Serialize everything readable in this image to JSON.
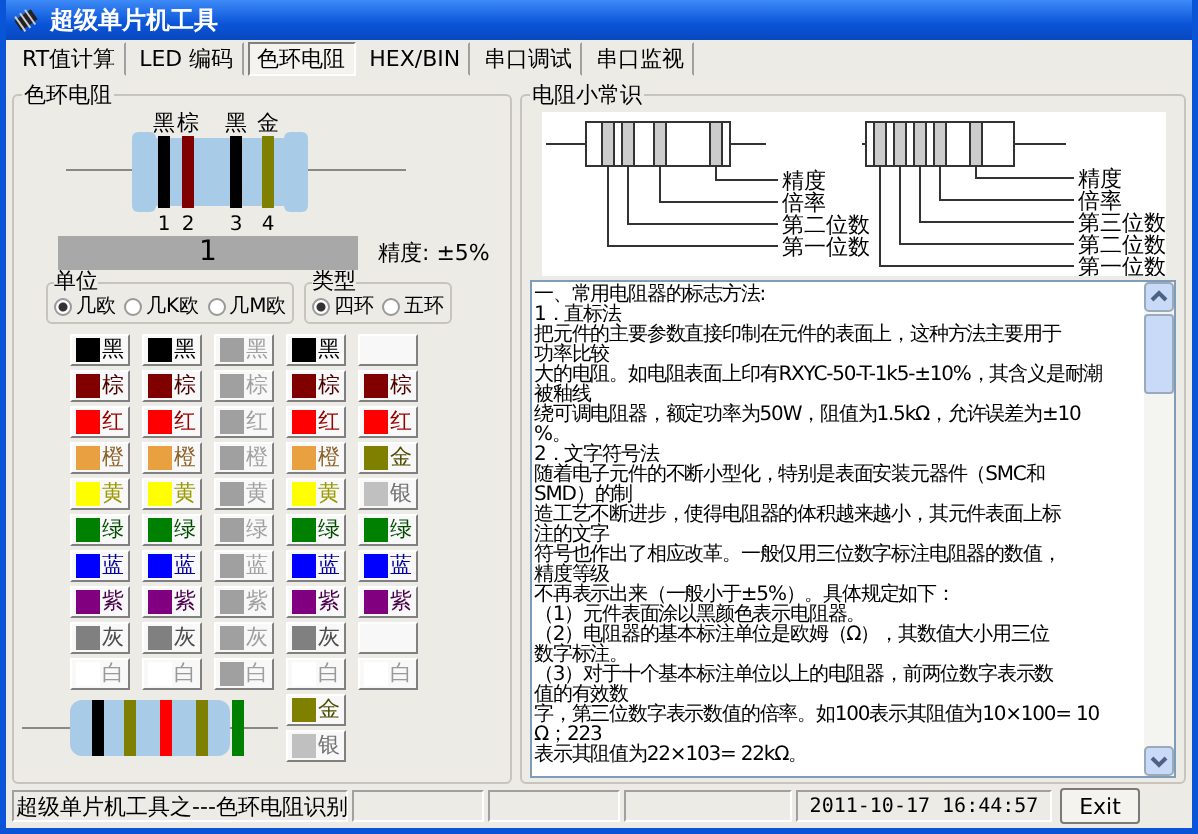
{
  "window": {
    "title": "超级单片机工具"
  },
  "tabs": [
    {
      "label": "RT值计算",
      "selected": false
    },
    {
      "label": "LED 编码",
      "selected": false
    },
    {
      "label": "色环电阻",
      "selected": true
    },
    {
      "label": "HEX/BIN",
      "selected": false
    },
    {
      "label": "串口调试",
      "selected": false
    },
    {
      "label": "串口监视",
      "selected": false
    }
  ],
  "color_ring_panel": {
    "title": "色环电阻",
    "resistor": {
      "bands": [
        {
          "name": "黑",
          "number": "1",
          "color": "#000000"
        },
        {
          "name": "棕",
          "number": "2",
          "color": "#800000"
        },
        {
          "name": "黑",
          "number": "3",
          "color": "#000000"
        },
        {
          "name": "金",
          "number": "4",
          "color": "#808000"
        }
      ]
    },
    "value": "1",
    "precision": "精度: ±5%",
    "unit_group": {
      "title": "单位",
      "options": [
        {
          "label": "几欧",
          "selected": true
        },
        {
          "label": "几K欧",
          "selected": false
        },
        {
          "label": "几M欧",
          "selected": false
        }
      ]
    },
    "type_group": {
      "title": "类型",
      "options": [
        {
          "label": "四环",
          "selected": true
        },
        {
          "label": "五环",
          "selected": false
        }
      ]
    },
    "band_columns": [
      {
        "disabled": false,
        "buttons": [
          {
            "kind": "swatch",
            "label": "黑",
            "color": "#000000"
          },
          {
            "kind": "swatch",
            "label": "棕",
            "color": "#800000"
          },
          {
            "kind": "swatch",
            "label": "红",
            "color": "#ff0000"
          },
          {
            "kind": "swatch",
            "label": "橙",
            "color": "#e8a040"
          },
          {
            "kind": "swatch",
            "label": "黄",
            "color": "#ffff00"
          },
          {
            "kind": "swatch",
            "label": "绿",
            "color": "#008000"
          },
          {
            "kind": "swatch",
            "label": "蓝",
            "color": "#0000ff"
          },
          {
            "kind": "swatch",
            "label": "紫",
            "color": "#800080"
          },
          {
            "kind": "swatch",
            "label": "灰",
            "color": "#808080"
          },
          {
            "kind": "swatch",
            "label": "白",
            "color": "#ffffff"
          }
        ]
      },
      {
        "disabled": false,
        "buttons": [
          {
            "kind": "swatch",
            "label": "黑",
            "color": "#000000"
          },
          {
            "kind": "swatch",
            "label": "棕",
            "color": "#800000"
          },
          {
            "kind": "swatch",
            "label": "红",
            "color": "#ff0000"
          },
          {
            "kind": "swatch",
            "label": "橙",
            "color": "#e8a040"
          },
          {
            "kind": "swatch",
            "label": "黄",
            "color": "#ffff00"
          },
          {
            "kind": "swatch",
            "label": "绿",
            "color": "#008000"
          },
          {
            "kind": "swatch",
            "label": "蓝",
            "color": "#0000ff"
          },
          {
            "kind": "swatch",
            "label": "紫",
            "color": "#800080"
          },
          {
            "kind": "swatch",
            "label": "灰",
            "color": "#808080"
          },
          {
            "kind": "swatch",
            "label": "白",
            "color": "#ffffff"
          }
        ]
      },
      {
        "disabled": true,
        "buttons": [
          {
            "kind": "swatch",
            "label": "黑"
          },
          {
            "kind": "swatch",
            "label": "棕"
          },
          {
            "kind": "swatch",
            "label": "红"
          },
          {
            "kind": "swatch",
            "label": "橙"
          },
          {
            "kind": "swatch",
            "label": "黄"
          },
          {
            "kind": "swatch",
            "label": "绿"
          },
          {
            "kind": "swatch",
            "label": "蓝"
          },
          {
            "kind": "swatch",
            "label": "紫"
          },
          {
            "kind": "swatch",
            "label": "灰"
          },
          {
            "kind": "swatch",
            "label": "白"
          }
        ]
      },
      {
        "disabled": false,
        "buttons": [
          {
            "kind": "swatch",
            "label": "黑",
            "color": "#000000"
          },
          {
            "kind": "swatch",
            "label": "棕",
            "color": "#800000"
          },
          {
            "kind": "swatch",
            "label": "红",
            "color": "#ff0000"
          },
          {
            "kind": "swatch",
            "label": "橙",
            "color": "#e8a040"
          },
          {
            "kind": "swatch",
            "label": "黄",
            "color": "#ffff00"
          },
          {
            "kind": "swatch",
            "label": "绿",
            "color": "#008000"
          },
          {
            "kind": "swatch",
            "label": "蓝",
            "color": "#0000ff"
          },
          {
            "kind": "swatch",
            "label": "紫",
            "color": "#800080"
          },
          {
            "kind": "swatch",
            "label": "灰",
            "color": "#808080"
          },
          {
            "kind": "swatch",
            "label": "白",
            "color": "#ffffff"
          },
          {
            "kind": "swatch",
            "label": "金",
            "color": "#808000"
          },
          {
            "kind": "swatch",
            "label": "银",
            "color": "#c0c0c0"
          }
        ]
      },
      {
        "disabled": false,
        "buttons": [
          {
            "kind": "blank"
          },
          {
            "kind": "swatch",
            "label": "棕",
            "color": "#800000"
          },
          {
            "kind": "swatch",
            "label": "红",
            "color": "#ff0000"
          },
          {
            "kind": "swatch",
            "label": "金",
            "color": "#808000"
          },
          {
            "kind": "swatch",
            "label": "银",
            "color": "#c0c0c0"
          },
          {
            "kind": "swatch",
            "label": "绿",
            "color": "#008000"
          },
          {
            "kind": "swatch",
            "label": "蓝",
            "color": "#0000ff"
          },
          {
            "kind": "swatch",
            "label": "紫",
            "color": "#800080"
          },
          {
            "kind": "blank"
          },
          {
            "kind": "swatch",
            "label": "白",
            "color": "#ffffff"
          }
        ]
      }
    ],
    "preview_resistor": {
      "bands": [
        {
          "color": "#000000"
        },
        {
          "color": "#808000"
        },
        {
          "color": "#ff0000"
        },
        {
          "color": "#808000"
        },
        {
          "color": "#008000"
        }
      ]
    }
  },
  "info_panel": {
    "title": "电阻小常识",
    "diagram": {
      "four_band_labels": [
        "精度",
        "倍率",
        "第二位数",
        "第一位数"
      ],
      "five_band_labels": [
        "精度",
        "倍率",
        "第三位数",
        "第二位数",
        "第一位数"
      ]
    },
    "text_lines": [
      "一、常用电阻器的标志方法:",
      "1．直标法",
      "把元件的主要参数直接印制在元件的表面上，这种方法主要用于",
      "功率比较",
      "大的电阻。如电阻表面上印有RXYC-50-T-1k5-±10%，其含义是耐潮",
      "被釉线",
      "绕可调电阻器，额定功率为50W，阻值为1.5kΩ，允许误差为±10",
      "%。",
      "2．文字符号法",
      "随着电子元件的不断小型化，特别是表面安装元器件（SMC和",
      "SMD）的制",
      "造工艺不断进步，使得电阻器的体积越来越小，其元件表面上标",
      "注的文字",
      "符号也作出了相应改革。一般仅用三位数字标注电阻器的数值，",
      "精度等级",
      "不再表示出来（一般小于±5%）。具体规定如下：",
      "（1）元件表面涂以黑颜色表示电阻器。",
      "（2）电阻器的基本标注单位是欧姆（Ω），其数值大小用三位",
      "数字标注。",
      "（3）对于十个基本标注单位以上的电阻器，前两位数字表示数",
      "值的有效数",
      "字，第三位数字表示数值的倍率。如100表示其阻值为10×100= 10",
      "Ω；223",
      "表示其阻值为22×103= 22kΩ。"
    ]
  },
  "status_bar": {
    "message": "超级单片机工具之---色环电阻识别",
    "datetime": "2011-10-17 16:44:57",
    "exit_button": "Exit"
  }
}
